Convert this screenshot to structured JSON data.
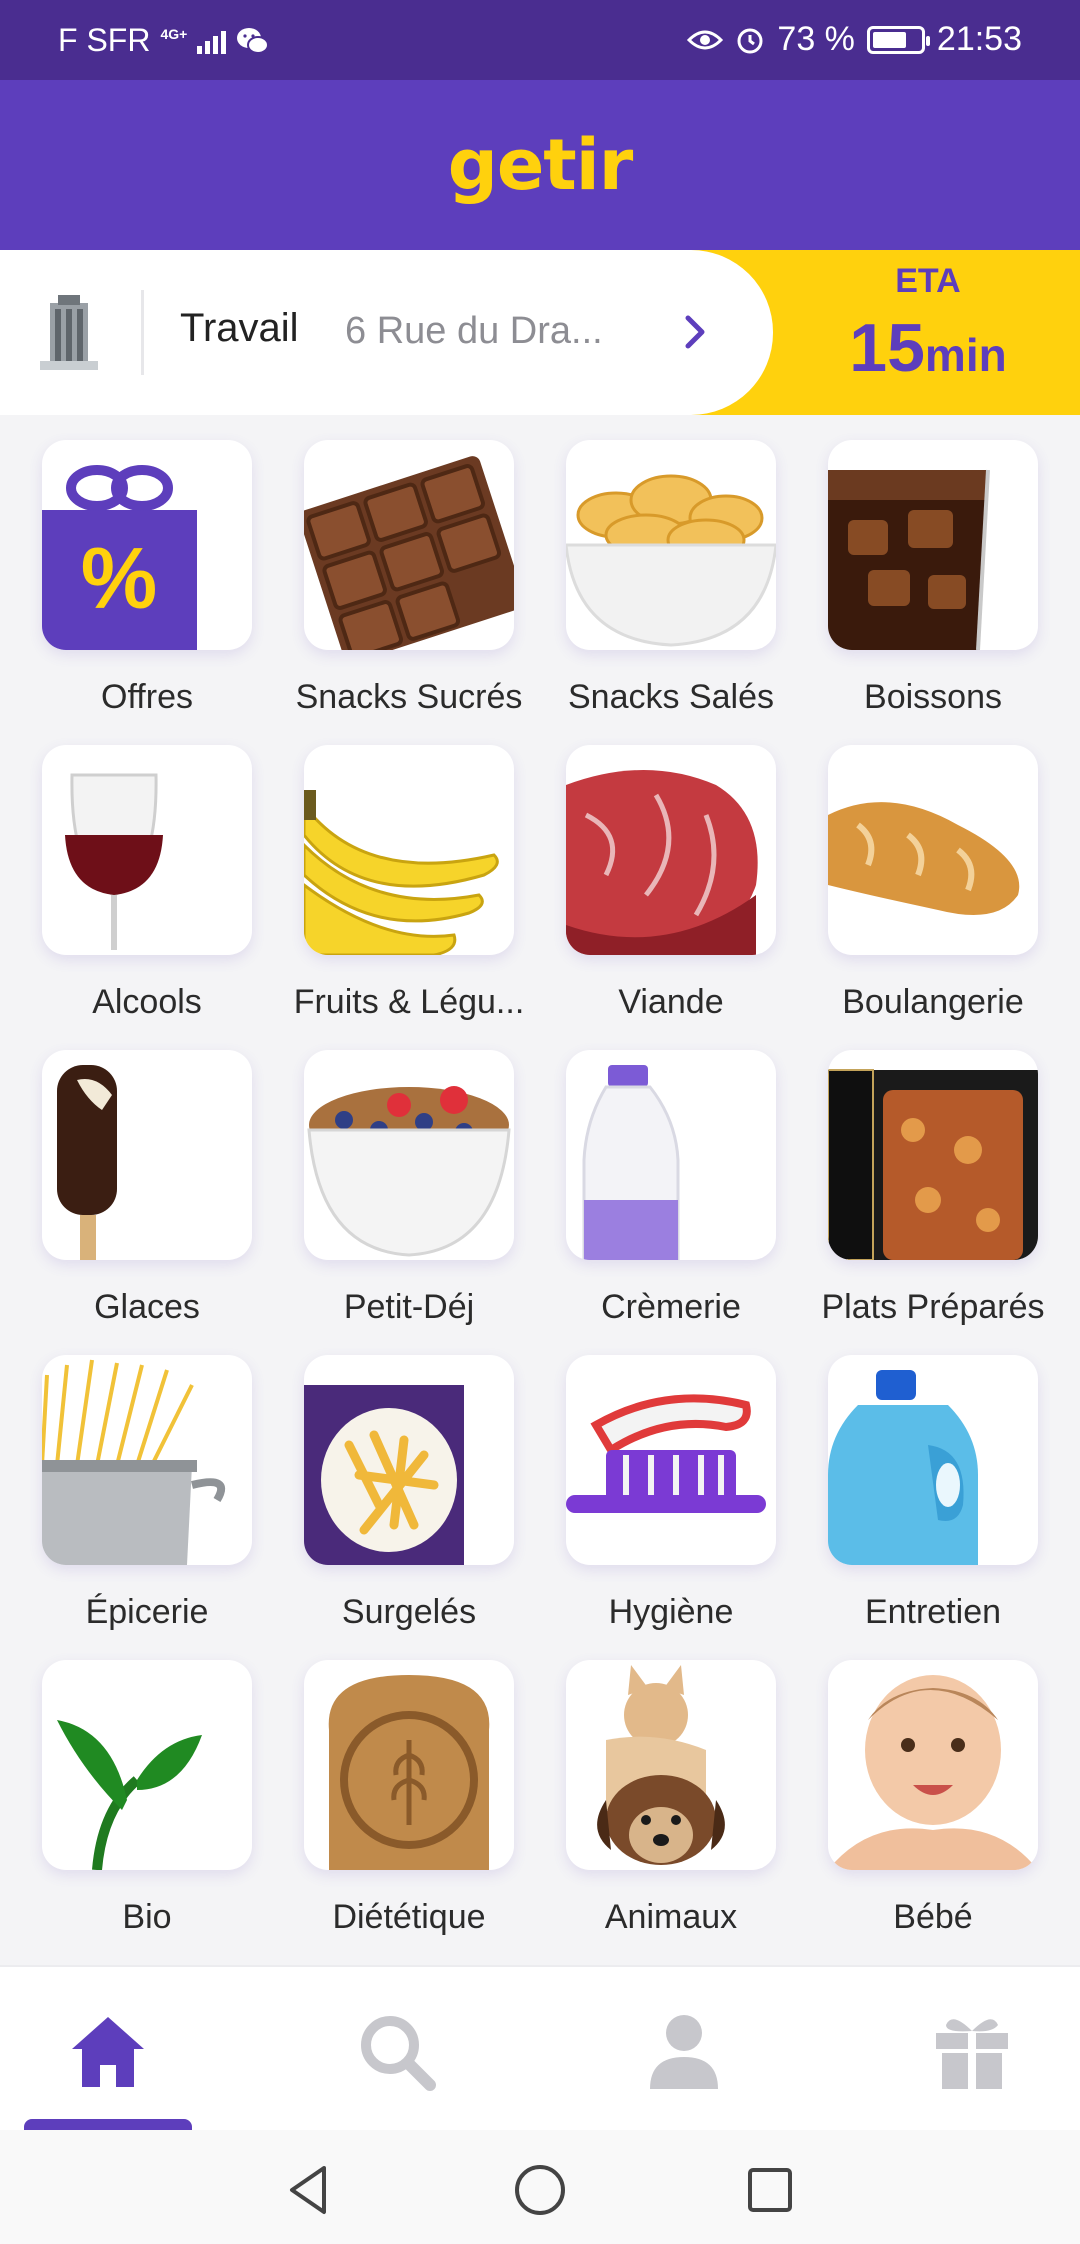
{
  "status_bar": {
    "carrier": "F SFR",
    "network_type": "4G+",
    "battery_percent": "73 %",
    "battery_level": 0.73,
    "time": "21:53"
  },
  "header": {
    "logo_text": "getir"
  },
  "address": {
    "label": "Travail",
    "text": "6 Rue du Dra...",
    "eta_label": "ETA",
    "eta_number": "15",
    "eta_unit": "min"
  },
  "categories": [
    {
      "label": "Offres",
      "icon": "gift-percent-icon"
    },
    {
      "label": "Snacks Sucrés",
      "icon": "chocolate-icon"
    },
    {
      "label": "Snacks Salés",
      "icon": "chips-bowl-icon"
    },
    {
      "label": "Boissons",
      "icon": "cola-glass-icon"
    },
    {
      "label": "Alcools",
      "icon": "wine-glass-icon"
    },
    {
      "label": "Fruits & Légu...",
      "icon": "bananas-icon"
    },
    {
      "label": "Viande",
      "icon": "steak-icon"
    },
    {
      "label": "Boulangerie",
      "icon": "baguette-icon"
    },
    {
      "label": "Glaces",
      "icon": "ice-cream-bar-icon"
    },
    {
      "label": "Petit-Déj",
      "icon": "cereal-bowl-icon"
    },
    {
      "label": "Crèmerie",
      "icon": "milk-bottle-icon"
    },
    {
      "label": "Plats Préparés",
      "icon": "lasagna-tray-icon"
    },
    {
      "label": "Épicerie",
      "icon": "pasta-pot-icon"
    },
    {
      "label": "Surgelés",
      "icon": "frozen-fries-icon"
    },
    {
      "label": "Hygiène",
      "icon": "toothbrush-icon"
    },
    {
      "label": "Entretien",
      "icon": "detergent-bottle-icon"
    },
    {
      "label": "Bio",
      "icon": "sprout-icon"
    },
    {
      "label": "Diététique",
      "icon": "wholegrain-bread-icon"
    },
    {
      "label": "Animaux",
      "icon": "cat-dog-icon"
    },
    {
      "label": "Bébé",
      "icon": "baby-icon"
    }
  ],
  "bottom_nav": [
    {
      "name": "home",
      "icon": "home-icon",
      "active": true
    },
    {
      "name": "search",
      "icon": "search-icon",
      "active": false
    },
    {
      "name": "profile",
      "icon": "profile-icon",
      "active": false
    },
    {
      "name": "gifts",
      "icon": "gift-icon",
      "active": false
    }
  ],
  "colors": {
    "brand_purple": "#5d3ebc",
    "brand_yellow": "#ffd10d",
    "status_bar": "#4a2d90",
    "inactive_icon": "#c7c7cc"
  }
}
